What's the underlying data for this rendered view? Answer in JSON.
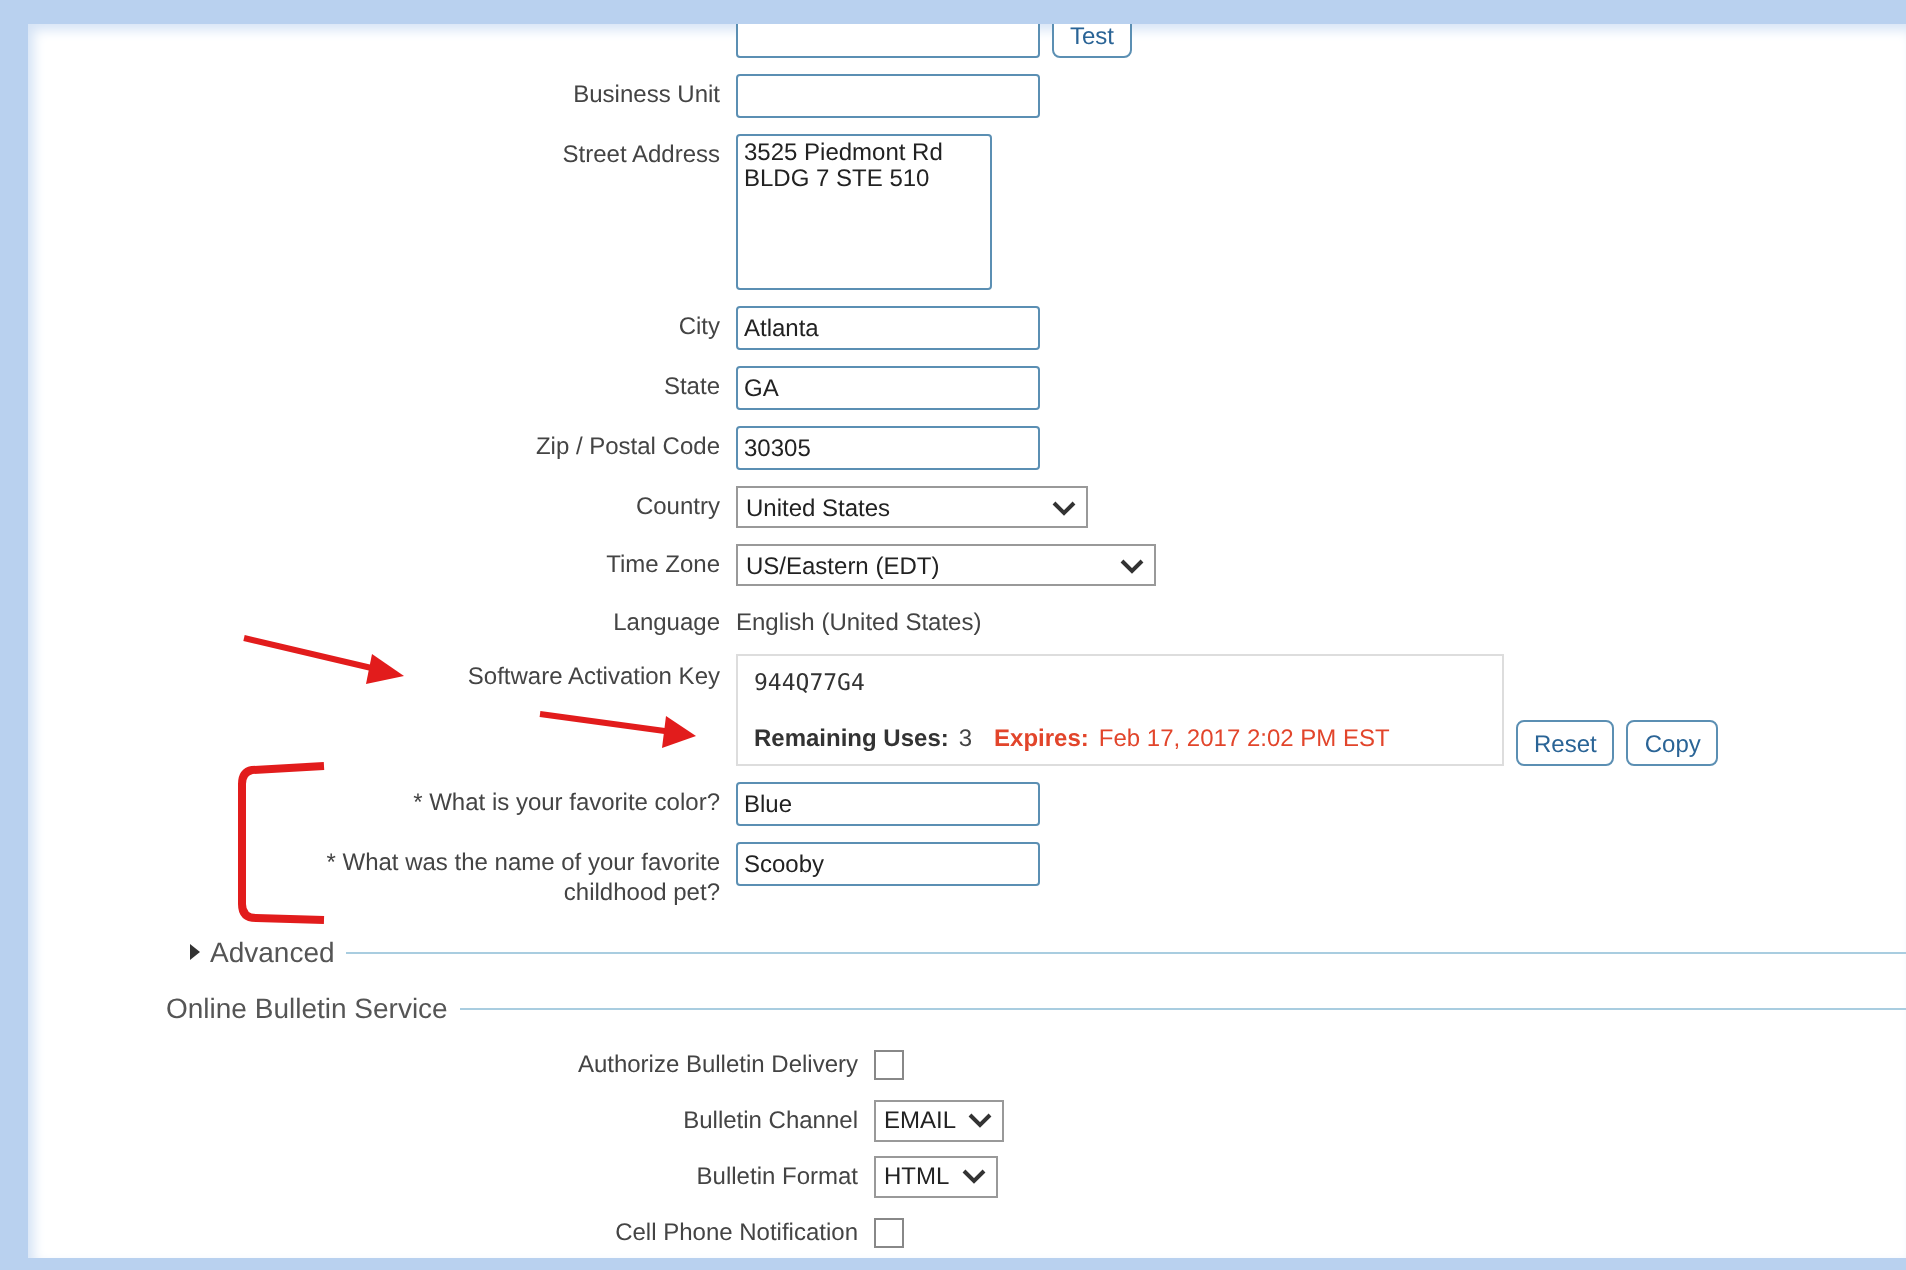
{
  "form": {
    "fields": [
      {
        "kind": "text",
        "button": "Test"
      },
      {
        "kind": "text",
        "label": "Business Unit"
      },
      {
        "kind": "textarea",
        "label": "Street Address",
        "value": "3525 Piedmont Rd\nBLDG 7 STE 510"
      },
      {
        "kind": "text",
        "label": "City",
        "value": "Atlanta"
      },
      {
        "kind": "text",
        "label": "State",
        "value": "GA"
      },
      {
        "kind": "text",
        "label": "Zip / Postal Code",
        "value": "30305"
      },
      {
        "kind": "select",
        "label": "Country",
        "value": "United States"
      },
      {
        "kind": "select",
        "label": "Time Zone",
        "value": "US/Eastern (EDT)"
      },
      {
        "kind": "static",
        "label": "Language",
        "value": "English (United States)"
      },
      {
        "kind": "activation",
        "label": "Software Activation Key",
        "value": "944Q77G4",
        "remaining_label": "Remaining Uses:",
        "remaining": "3",
        "expires_label": "Expires:",
        "expires": "Feb 17, 2017 2:02 PM EST",
        "buttons": [
          "Reset",
          "Copy"
        ]
      },
      {
        "kind": "text",
        "label": "* What is your favorite color?",
        "value": "Blue"
      },
      {
        "kind": "text",
        "label": "* What was the name of your favorite childhood pet?",
        "value": "Scooby"
      }
    ]
  },
  "advanced": {
    "label": "Advanced",
    "expanded": false
  },
  "bulletin": {
    "title": "Online Bulletin Service",
    "fields": [
      {
        "kind": "checkbox",
        "label": "Authorize Bulletin Delivery",
        "checked": false
      },
      {
        "kind": "select",
        "label": "Bulletin Channel",
        "value": "EMAIL"
      },
      {
        "kind": "select",
        "label": "Bulletin Format",
        "value": "HTML"
      },
      {
        "kind": "checkbox",
        "label": "Cell Phone Notification",
        "checked": false
      }
    ]
  }
}
